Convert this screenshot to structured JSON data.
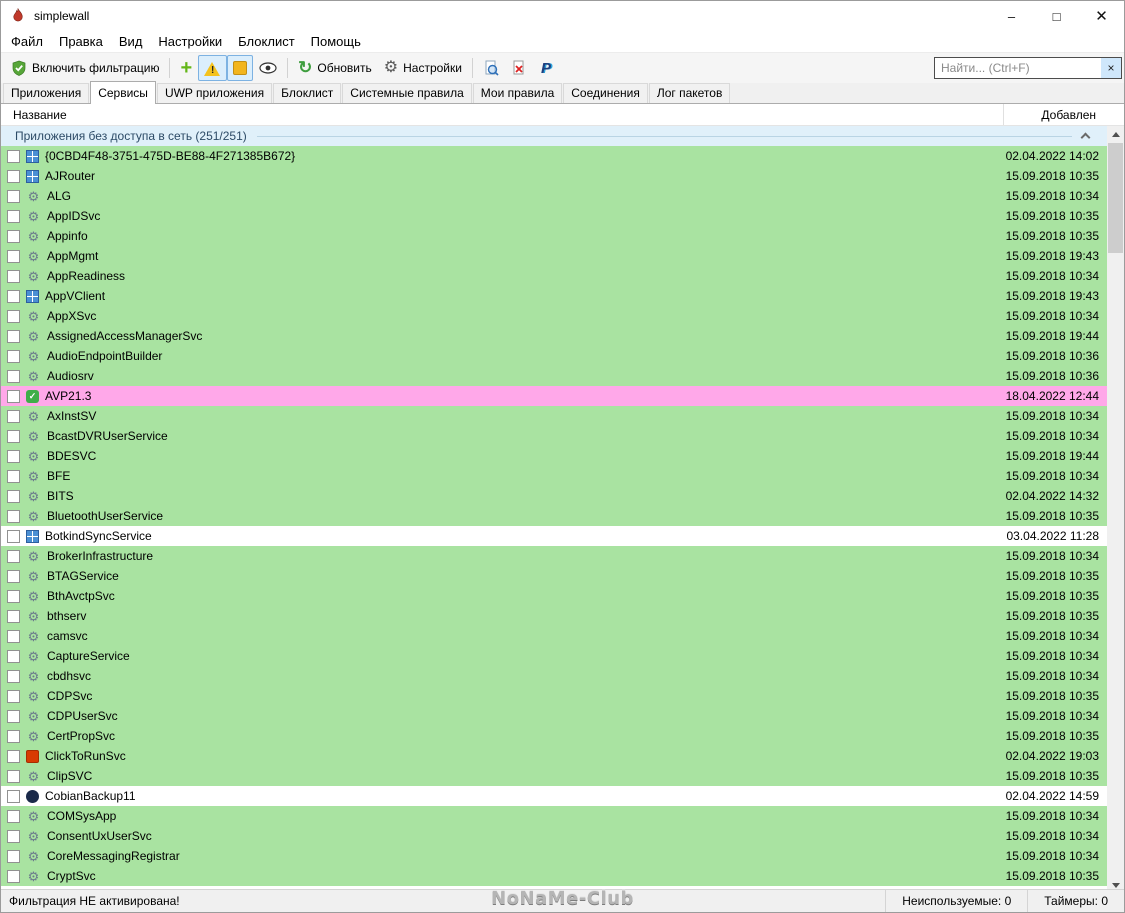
{
  "window": {
    "title": "simplewall",
    "controls": {
      "minimize": "–",
      "maximize": "□",
      "close": "✕"
    }
  },
  "menu": {
    "items": [
      "Файл",
      "Правка",
      "Вид",
      "Настройки",
      "Блоклист",
      "Помощь"
    ]
  },
  "toolbar": {
    "enable_filtering_label": "Включить фильтрацию",
    "refresh_label": "Обновить",
    "settings_label": "Настройки",
    "search_placeholder": "Найти... (Ctrl+F)"
  },
  "icons": {
    "plus": "+",
    "refresh": "↻",
    "gear": "⚙",
    "close": "×"
  },
  "tabs": [
    {
      "label": "Приложения",
      "active": false
    },
    {
      "label": "Сервисы",
      "active": true
    },
    {
      "label": "UWP приложения",
      "active": false
    },
    {
      "label": "Блоклист",
      "active": false
    },
    {
      "label": "Системные правила",
      "active": false
    },
    {
      "label": "Мои правила",
      "active": false
    },
    {
      "label": "Соединения",
      "active": false
    },
    {
      "label": "Лог пакетов",
      "active": false
    }
  ],
  "list": {
    "columns": [
      "Название",
      "Добавлен"
    ],
    "group": {
      "label": "Приложения без доступа в сеть (251/251)"
    },
    "rows": [
      {
        "name": "{0CBD4F48-3751-475D-BE88-4F271385B672}",
        "added": "02.04.2022 14:02",
        "bg": "green",
        "icon": "window-blue"
      },
      {
        "name": "AJRouter",
        "added": "15.09.2018 10:35",
        "bg": "green",
        "icon": "window-blue"
      },
      {
        "name": "ALG",
        "added": "15.09.2018 10:34",
        "bg": "green",
        "icon": "gear"
      },
      {
        "name": "AppIDSvc",
        "added": "15.09.2018 10:35",
        "bg": "green",
        "icon": "gear"
      },
      {
        "name": "Appinfo",
        "added": "15.09.2018 10:35",
        "bg": "green",
        "icon": "gear"
      },
      {
        "name": "AppMgmt",
        "added": "15.09.2018 19:43",
        "bg": "green",
        "icon": "gear"
      },
      {
        "name": "AppReadiness",
        "added": "15.09.2018 10:34",
        "bg": "green",
        "icon": "gear"
      },
      {
        "name": "AppVClient",
        "added": "15.09.2018 19:43",
        "bg": "green",
        "icon": "window-blue"
      },
      {
        "name": "AppXSvc",
        "added": "15.09.2018 10:34",
        "bg": "green",
        "icon": "gear"
      },
      {
        "name": "AssignedAccessManagerSvc",
        "added": "15.09.2018 19:44",
        "bg": "green",
        "icon": "gear"
      },
      {
        "name": "AudioEndpointBuilder",
        "added": "15.09.2018 10:36",
        "bg": "green",
        "icon": "gear"
      },
      {
        "name": "Audiosrv",
        "added": "15.09.2018 10:36",
        "bg": "green",
        "icon": "gear"
      },
      {
        "name": "AVP21.3",
        "added": "18.04.2022 12:44",
        "bg": "pink",
        "icon": "shield-green"
      },
      {
        "name": "AxInstSV",
        "added": "15.09.2018 10:34",
        "bg": "green",
        "icon": "gear"
      },
      {
        "name": "BcastDVRUserService",
        "added": "15.09.2018 10:34",
        "bg": "green",
        "icon": "gear"
      },
      {
        "name": "BDESVC",
        "added": "15.09.2018 19:44",
        "bg": "green",
        "icon": "gear"
      },
      {
        "name": "BFE",
        "added": "15.09.2018 10:34",
        "bg": "green",
        "icon": "gear"
      },
      {
        "name": "BITS",
        "added": "02.04.2022 14:32",
        "bg": "green",
        "icon": "gear"
      },
      {
        "name": "BluetoothUserService",
        "added": "15.09.2018 10:35",
        "bg": "green",
        "icon": "gear"
      },
      {
        "name": "BotkindSyncService",
        "added": "03.04.2022 11:28",
        "bg": "white",
        "icon": "window-blue"
      },
      {
        "name": "BrokerInfrastructure",
        "added": "15.09.2018 10:34",
        "bg": "green",
        "icon": "gear"
      },
      {
        "name": "BTAGService",
        "added": "15.09.2018 10:35",
        "bg": "green",
        "icon": "gear"
      },
      {
        "name": "BthAvctpSvc",
        "added": "15.09.2018 10:35",
        "bg": "green",
        "icon": "gear"
      },
      {
        "name": "bthserv",
        "added": "15.09.2018 10:35",
        "bg": "green",
        "icon": "gear"
      },
      {
        "name": "camsvc",
        "added": "15.09.2018 10:34",
        "bg": "green",
        "icon": "gear"
      },
      {
        "name": "CaptureService",
        "added": "15.09.2018 10:34",
        "bg": "green",
        "icon": "gear"
      },
      {
        "name": "cbdhsvc",
        "added": "15.09.2018 10:34",
        "bg": "green",
        "icon": "gear"
      },
      {
        "name": "CDPSvc",
        "added": "15.09.2018 10:35",
        "bg": "green",
        "icon": "gear"
      },
      {
        "name": "CDPUserSvc",
        "added": "15.09.2018 10:34",
        "bg": "green",
        "icon": "gear"
      },
      {
        "name": "CertPropSvc",
        "added": "15.09.2018 10:35",
        "bg": "green",
        "icon": "gear"
      },
      {
        "name": "ClickToRunSvc",
        "added": "02.04.2022 19:03",
        "bg": "green",
        "icon": "box-orange"
      },
      {
        "name": "ClipSVC",
        "added": "15.09.2018 10:35",
        "bg": "green",
        "icon": "gear"
      },
      {
        "name": "CobianBackup11",
        "added": "02.04.2022 14:59",
        "bg": "white",
        "icon": "circle-dark"
      },
      {
        "name": "COMSysApp",
        "added": "15.09.2018 10:34",
        "bg": "green",
        "icon": "gear"
      },
      {
        "name": "ConsentUxUserSvc",
        "added": "15.09.2018 10:34",
        "bg": "green",
        "icon": "gear"
      },
      {
        "name": "CoreMessagingRegistrar",
        "added": "15.09.2018 10:34",
        "bg": "green",
        "icon": "gear"
      },
      {
        "name": "CryptSvc",
        "added": "15.09.2018 10:35",
        "bg": "green",
        "icon": "gear"
      }
    ]
  },
  "statusbar": {
    "left": "Фильтрация НЕ активирована!",
    "watermark": "NoNaMe-Club",
    "unused": "Неиспользуемые: 0",
    "timers": "Таймеры: 0"
  },
  "colors": {
    "row_green": "#a9e3a1",
    "row_pink": "#ffa8e9",
    "group_bg": "#e0f0fa",
    "toolbar_active_bg": "#dbeefc"
  }
}
